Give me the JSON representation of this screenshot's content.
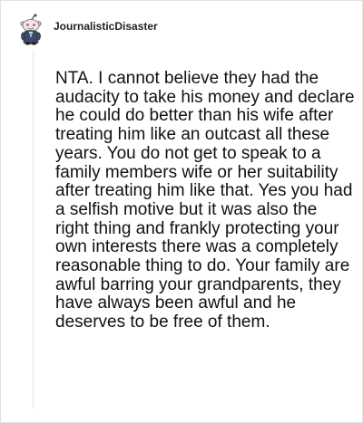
{
  "comment": {
    "username": "JournalisticDisaster",
    "avatar_icon": "reddit-snoo-avatar-icon",
    "body": "NTA. I cannot believe they had the audacity to take his money and declare he could do better than his wife after treating him like an outcast all these years. You do not get to speak to a family members wife or her suitability after treating him like that. Yes you had a selfish motive but it was also the right thing and frankly protecting your own interests there was a completely reasonable thing to do. Your family are awful barring your grandparents, they have always been awful and he deserves to be free of them."
  },
  "colors": {
    "background": "#ffffff",
    "border": "#e2e2e2",
    "text": "#111111",
    "thread_line": "#e6e6e6"
  }
}
